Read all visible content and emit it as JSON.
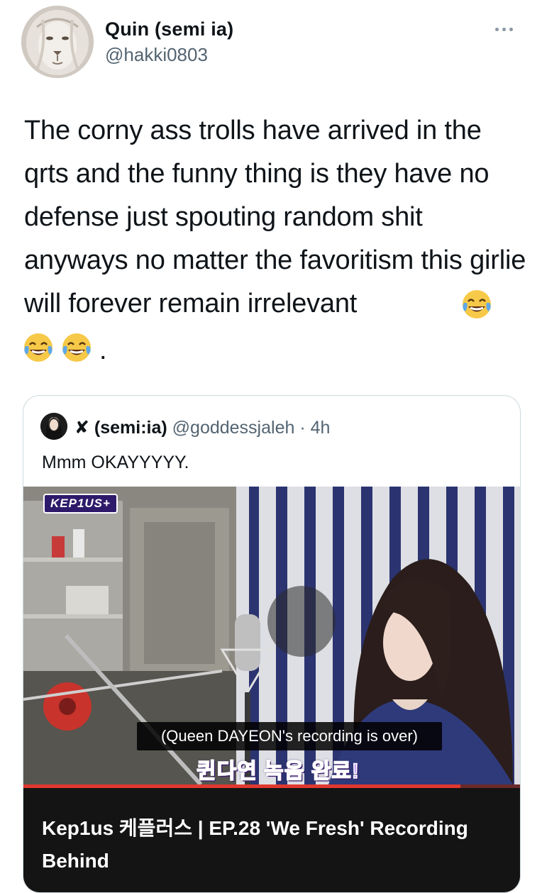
{
  "author": {
    "display_name": "Quin (semi ia)",
    "handle": "@hakki0803",
    "avatar_icon": "lion-avatar"
  },
  "more_icon": "more-options-icon",
  "tweet": {
    "text": "The corny ass trolls have arrived in the qrts  and the funny thing is they have no defense just spouting random shit anyways no matter the favoritism this girlie will forever remain irrelevant",
    "emoji": "face-with-tears-of-joy-icon",
    "trailing": "."
  },
  "quote": {
    "name": "✘ (semi:ia)",
    "handle": "@goddessjaleh",
    "separator": "·",
    "time": "4h",
    "text": "Mmm OKAYYYYY.",
    "media": {
      "logo": "KEP1US+",
      "subtitle_en": "(Queen DAYEON's recording is over)",
      "subtitle_kr": "퀸다연 녹음 완료!",
      "progress": 0.88
    },
    "link_title": "Kep1us 케플러스 | EP.28 'We Fresh' Recording Behind"
  },
  "colors": {
    "text": "#0f1419",
    "secondary": "#536471",
    "border": "#cfd9de",
    "progress": "#e0382f"
  }
}
